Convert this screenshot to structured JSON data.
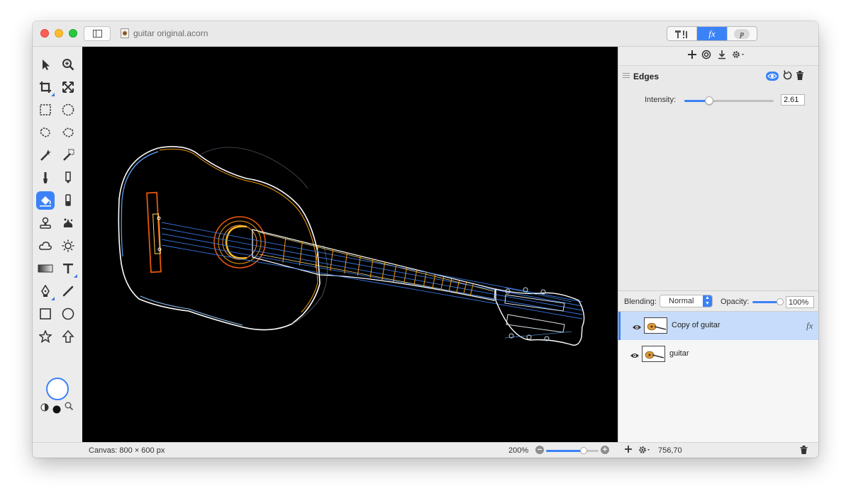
{
  "window": {
    "title": "guitar original.acorn"
  },
  "inspector_tabs": [
    {
      "label": "T!",
      "icon": "tools-icon"
    },
    {
      "label": "fx",
      "icon": "effects-icon"
    },
    {
      "label": "p",
      "icon": "properties-icon"
    }
  ],
  "toolbox": {
    "tools": [
      "select-arrow-icon",
      "zoom-icon",
      "crop-icon",
      "transform-icon",
      "rect-marquee-icon",
      "oval-marquee-icon",
      "lasso-icon",
      "polygon-lasso-icon",
      "magic-wand-icon",
      "magic-eraser-icon",
      "brush-icon",
      "pencil-icon",
      "flood-fill-icon",
      "eraser-icon",
      "clone-stamp-icon",
      "smudge-icon",
      "shape-cloud-icon",
      "sun-icon",
      "gradient-icon",
      "text-icon",
      "pen-icon",
      "line-icon",
      "rectangle-icon",
      "circle-icon",
      "star-icon",
      "arrow-up-icon"
    ],
    "selected_tool": "flood-fill-icon",
    "color_swatch": "#ffffff"
  },
  "status": {
    "canvas_size": "Canvas: 800 × 600 px",
    "zoom": "200%",
    "zoom_fraction": 0.72,
    "coordinates": "756,70"
  },
  "filter": {
    "name": "Edges",
    "intensity_label": "Intensity:",
    "intensity_value": "2.61",
    "intensity_fraction": 0.28
  },
  "layers_panel": {
    "blending_label": "Blending:",
    "blending_mode": "Normal",
    "opacity_label": "Opacity:",
    "opacity_value": "100%",
    "layers": [
      {
        "name": "Copy of guitar",
        "selected": true,
        "has_fx": true,
        "fx_label": "fx"
      },
      {
        "name": "guitar",
        "selected": false,
        "has_fx": false,
        "fx_label": ""
      }
    ]
  },
  "colors": {
    "accent": "#3b82f6",
    "canvas_background": "#000000",
    "selected_layer": "#c6dcfa"
  }
}
